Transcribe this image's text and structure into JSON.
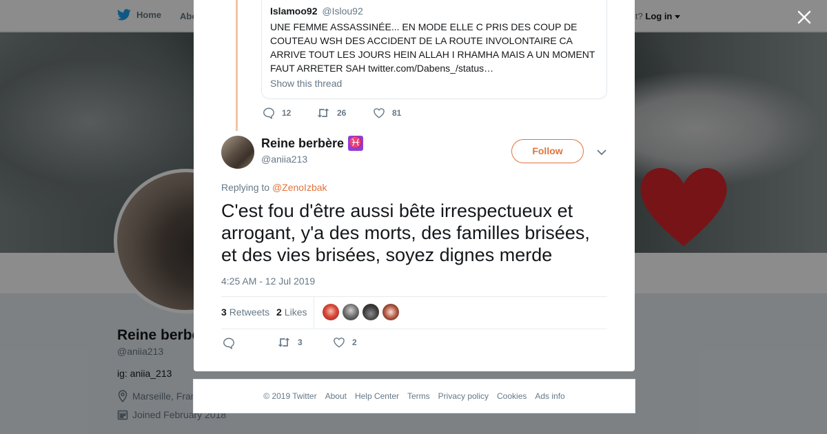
{
  "nav": {
    "home_label": "Home",
    "about_label": "Abo",
    "account_prompt": "account?",
    "login_label": "Log in"
  },
  "profile": {
    "name": "Reine berbè",
    "handle": "@aniia213",
    "bio": "ig: aniia_213",
    "location": "Marseille, Fran",
    "joined": "Joined February 2018"
  },
  "quoted_tweet": {
    "name": "Islamoo92",
    "handle": "@Islou92",
    "text": "UNE FEMME ASSASSINÉE... EN MODE ELLE C PRIS DES COUP DE COUTEAU WSH DES ACCIDENT DE LA ROUTE INVOLONTAIRE CA ARRIVE TOUT LES JOURS HEIN ALLAH I RHAMHA MAIS A UN MOMENT FAUT ARRETER SAH twitter.com/Dabens_/status…",
    "show_thread": "Show this thread"
  },
  "parent_actions": {
    "replies": "12",
    "retweets": "26",
    "likes": "81"
  },
  "tweet": {
    "name": "Reine berbère",
    "emoji": "♓",
    "handle": "@aniia213",
    "follow_label": "Follow",
    "replying_prefix": "Replying to",
    "replying_to": "@ZenoIzbak",
    "text": "C'est fou d'être aussi bête irrespectueux et arrogant, y'a des morts, des familles brisées, et des vies brisées, soyez dignes merde",
    "timestamp": "4:25 AM - 12 Jul 2019",
    "retweet_count": "3",
    "retweet_word": "Retweets",
    "like_count": "2",
    "like_word": "Likes",
    "action_retweets": "3",
    "action_likes": "2"
  },
  "footer": {
    "copyright": "© 2019 Twitter",
    "about": "About",
    "help": "Help Center",
    "terms": "Terms",
    "privacy": "Privacy policy",
    "cookies": "Cookies",
    "ads": "Ads info"
  },
  "colors": {
    "accent": "#e0733c",
    "twitter_blue": "#1da1f2",
    "thread_line": "#f5c3a3",
    "muted": "#657786"
  }
}
